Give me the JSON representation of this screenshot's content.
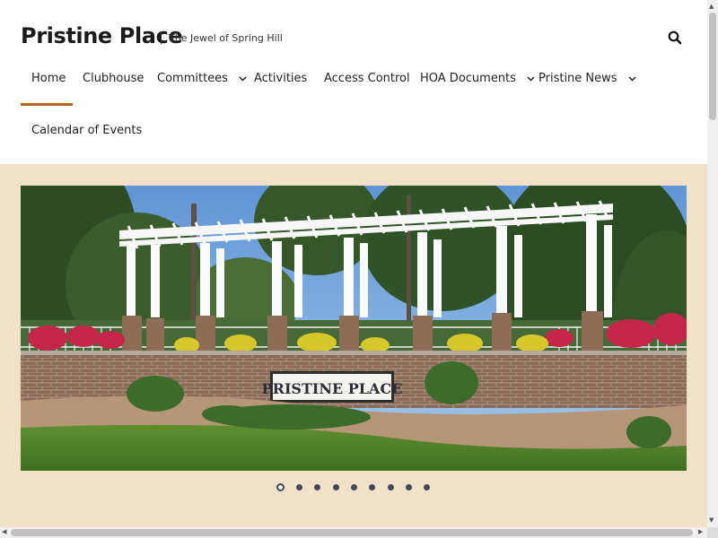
{
  "site": {
    "title": "Pristine Place",
    "tagline": "The Jewel of Spring Hill"
  },
  "nav": {
    "items": [
      {
        "label": "Home",
        "dropdown": false,
        "active": true
      },
      {
        "label": "Clubhouse",
        "dropdown": false
      },
      {
        "label": "Committees",
        "dropdown": true
      },
      {
        "label": "Activities",
        "dropdown": false
      },
      {
        "label": "Access Control",
        "dropdown": false
      },
      {
        "label": "HOA Documents",
        "dropdown": true
      },
      {
        "label": "Pristine News",
        "dropdown": true
      },
      {
        "label": "Calendar of Events",
        "dropdown": false
      }
    ]
  },
  "hero": {
    "sign_text": "PRISTINE PLACE",
    "slide_count": 9,
    "active_slide": 1
  },
  "colors": {
    "accent": "#b5651d",
    "section_bg": "#f1e1c8",
    "text": "#222222"
  },
  "icons": {
    "search": "search-icon",
    "dropdown": "chevron-down-icon"
  }
}
